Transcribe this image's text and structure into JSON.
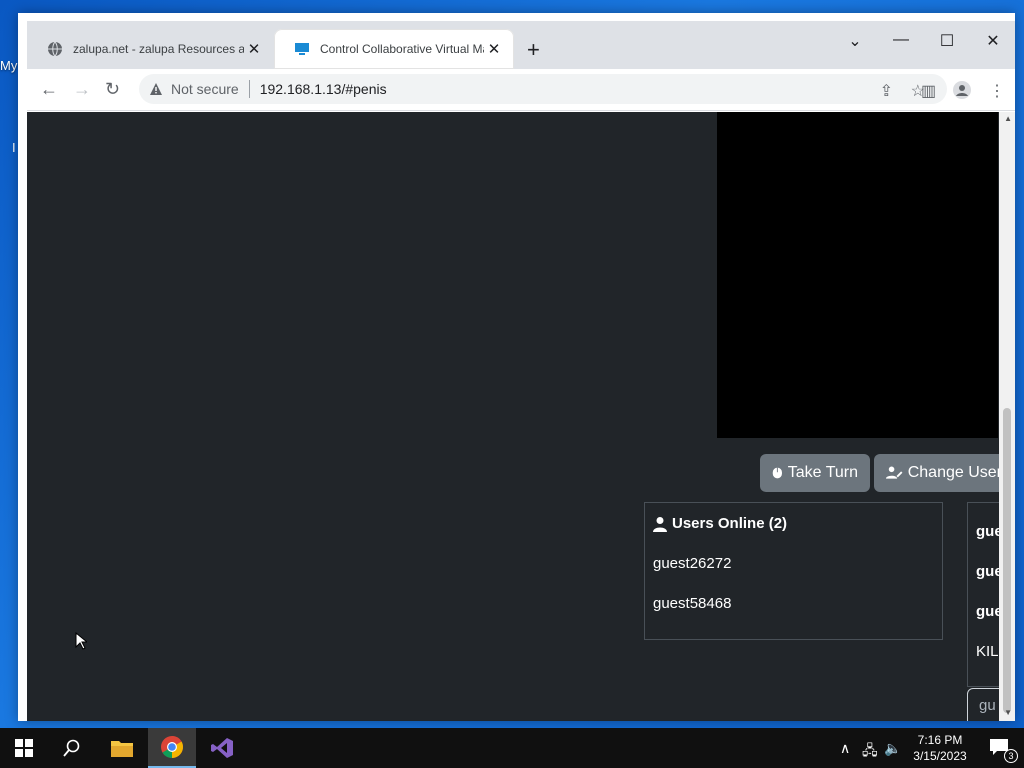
{
  "desktop": {
    "icon_label": "My",
    "icon_label_2": "I"
  },
  "browser": {
    "tabs": [
      {
        "title": "zalupa.net - zalupa Resources and",
        "close": "✕"
      },
      {
        "title": "Control Collaborative Virtual Mac",
        "close": "✕"
      }
    ],
    "new_tab": "+",
    "window_controls": {
      "dropdown": "⌄",
      "minimize": "—",
      "maximize": "☐",
      "close": "✕"
    },
    "address": {
      "security_label": "Not secure",
      "url": "192.168.1.13/#penis"
    }
  },
  "page": {
    "buttons": {
      "take_turn": "Take Turn",
      "change_user": "Change User"
    },
    "users_panel": {
      "heading": "Users Online (2)",
      "users": [
        "guest26272",
        "guest58468"
      ]
    },
    "chat": {
      "lines": [
        "gue",
        "gue",
        "gue",
        "KIL"
      ],
      "input_value": "gu"
    }
  },
  "taskbar": {
    "clock": {
      "time": "7:16 PM",
      "date": "3/15/2023"
    },
    "notification_count": "3"
  }
}
